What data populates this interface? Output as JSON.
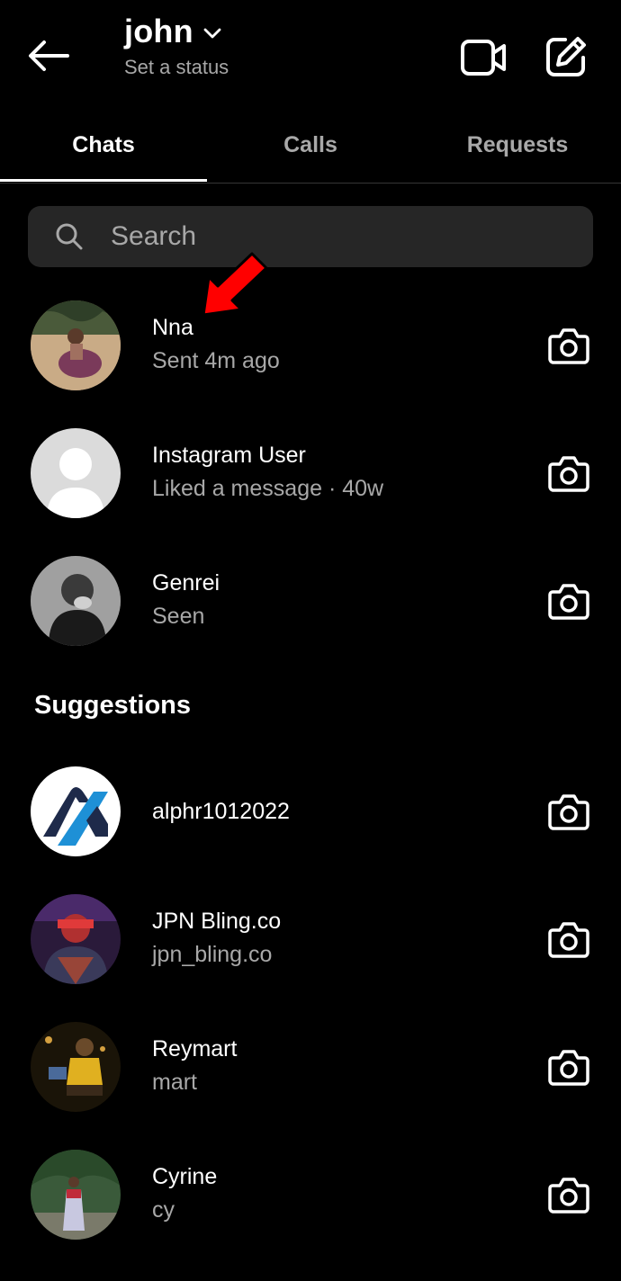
{
  "header": {
    "username": "john",
    "status": "Set a status"
  },
  "tabs": [
    {
      "label": "Chats",
      "active": true
    },
    {
      "label": "Calls",
      "active": false
    },
    {
      "label": "Requests",
      "active": false
    }
  ],
  "search": {
    "placeholder": "Search"
  },
  "chats": [
    {
      "name": "Nna",
      "sub": "Sent 4m ago",
      "avatar": "photo-person-beach"
    },
    {
      "name": "Instagram User",
      "sub": "Liked a message · 40w",
      "avatar": "default-avatar"
    },
    {
      "name": "Genrei",
      "sub": "Seen",
      "avatar": "photo-person-bw"
    }
  ],
  "suggestions_title": "Suggestions",
  "suggestions": [
    {
      "name": "alphr1012022",
      "sub": "",
      "avatar": "alphr-logo"
    },
    {
      "name": "JPN Bling.co",
      "sub": "jpn_bling.co",
      "avatar": "photo-person-red"
    },
    {
      "name": "Reymart",
      "sub": "mart",
      "avatar": "photo-person-night"
    },
    {
      "name": "Cyrine",
      "sub": "cy",
      "avatar": "photo-person-garden"
    }
  ],
  "colors": {
    "background": "#000000",
    "secondary_text": "#a8a8a8",
    "search_bg": "#262626",
    "annotation_arrow": "#ff0000"
  },
  "icons": {
    "back": "arrow-left-icon",
    "dropdown": "chevron-down-icon",
    "video": "video-camera-icon",
    "compose": "compose-icon",
    "search": "search-icon",
    "camera": "camera-icon"
  }
}
